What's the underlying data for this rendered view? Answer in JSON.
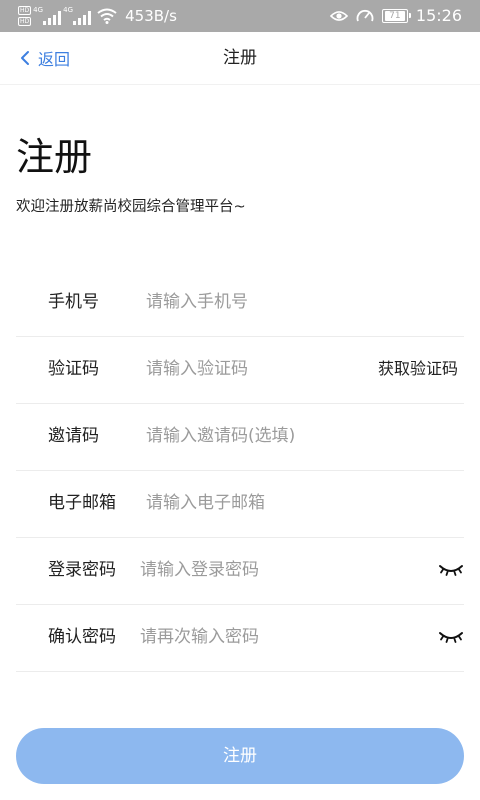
{
  "status_bar": {
    "hd_labels": [
      "HD",
      "HD"
    ],
    "network_tags": [
      "4G",
      "4G"
    ],
    "net_speed": "453B/s",
    "battery": "71",
    "time": "15:26",
    "icons": [
      "signal-icon",
      "wifi-icon",
      "eye-icon",
      "speedometer-icon",
      "battery-icon"
    ]
  },
  "nav": {
    "back_label": "返回",
    "title": "注册",
    "accent_color": "#3d7fe0"
  },
  "header": {
    "title": "注册",
    "subtitle": "欢迎注册放薪尚校园综合管理平台~"
  },
  "form": {
    "phone": {
      "label": "手机号",
      "placeholder": "请输入手机号",
      "value": ""
    },
    "code": {
      "label": "验证码",
      "placeholder": "请输入验证码",
      "value": "",
      "action_label": "获取验证码"
    },
    "invite": {
      "label": "邀请码",
      "placeholder": "请输入邀请码(选填)",
      "value": ""
    },
    "email": {
      "label": "电子邮箱",
      "placeholder": "请输入电子邮箱",
      "value": ""
    },
    "password": {
      "label": "登录密码",
      "placeholder": "请输入登录密码",
      "value": ""
    },
    "confirm": {
      "label": "确认密码",
      "placeholder": "请再次输入密码",
      "value": ""
    }
  },
  "submit": {
    "label": "注册",
    "color": "#8db8ef"
  }
}
